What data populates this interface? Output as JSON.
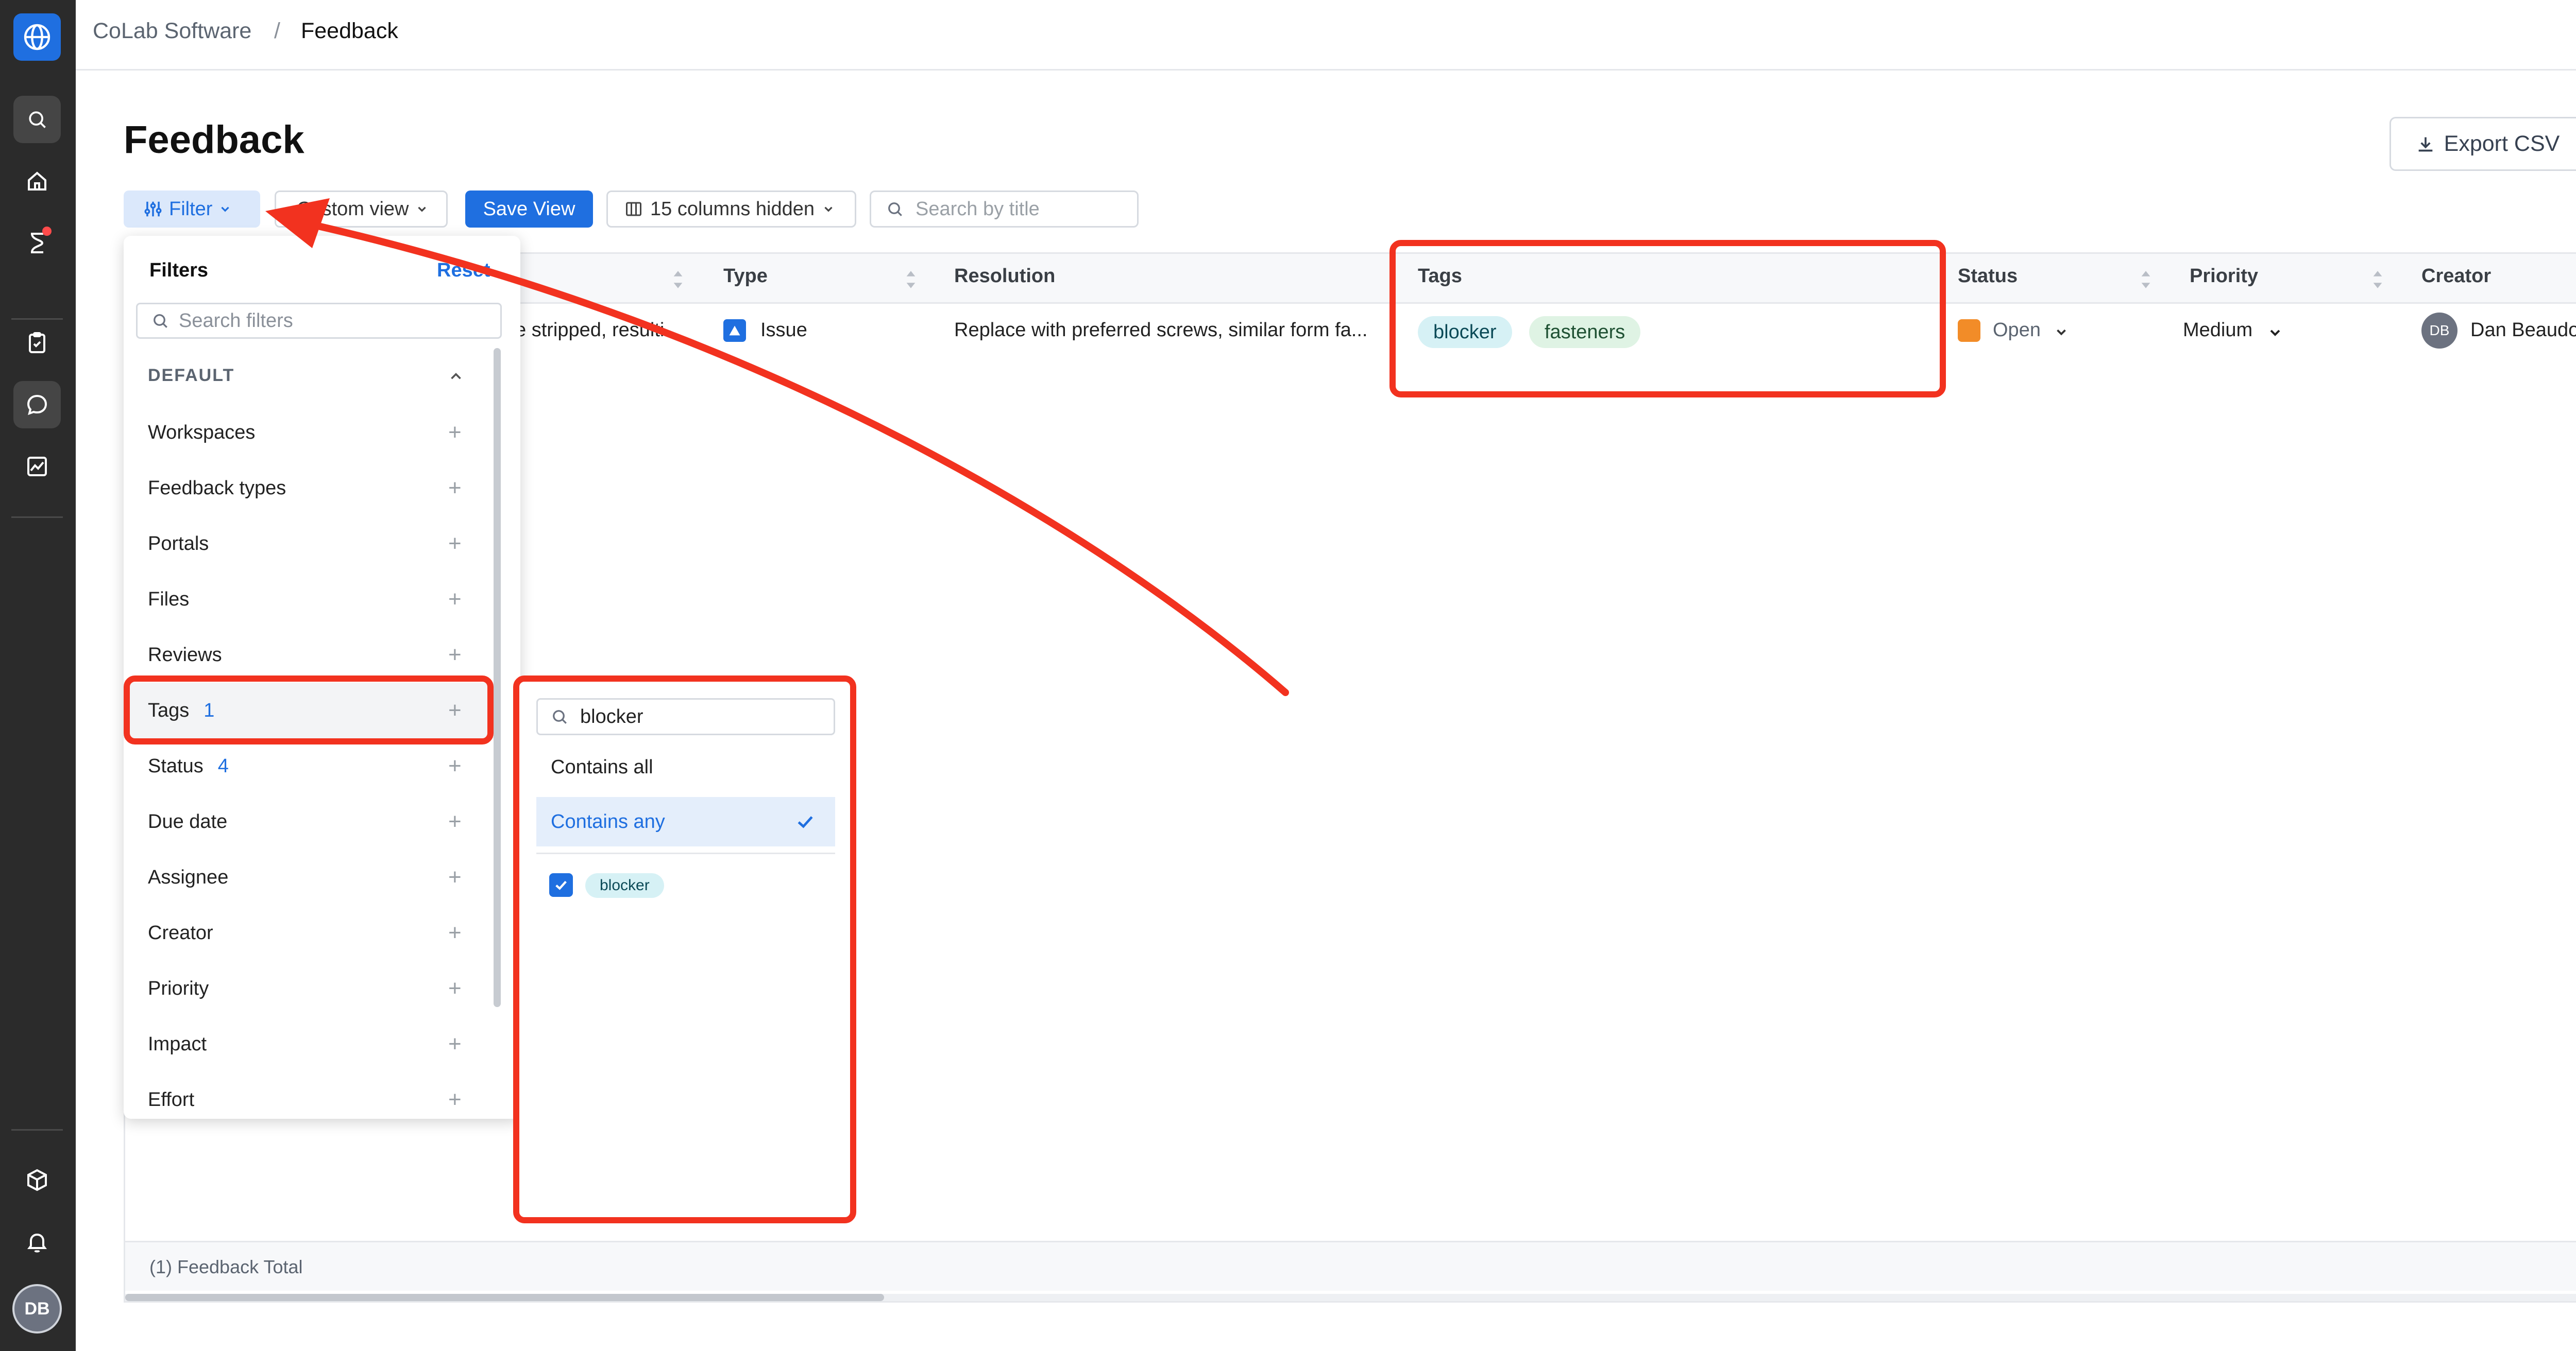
{
  "rail": {
    "items": [
      "globe-logo",
      "search",
      "home",
      "hourglass",
      "clipboard",
      "chat",
      "chart",
      "box",
      "bell"
    ],
    "avatar_initials": "DB"
  },
  "breadcrumb": {
    "workspace": "CoLab Software",
    "separator": "/",
    "current": "Feedback"
  },
  "page": {
    "title": "Feedback",
    "export_label": "Export CSV"
  },
  "toolbar": {
    "filter_label": "Filter",
    "custom_view_label": "Custom view",
    "save_view_label": "Save View",
    "columns_hidden_label": "15 columns hidden",
    "search_placeholder": "Search by title"
  },
  "table": {
    "columns": [
      "Type",
      "Resolution",
      "Tags",
      "Status",
      "Priority",
      "Creator"
    ],
    "row": {
      "description_fragment": "e stripped, resulti",
      "type": "Issue",
      "resolution": "Replace with preferred screws, similar form fa...",
      "tags": [
        "blocker",
        "fasteners"
      ],
      "status": "Open",
      "priority": "Medium",
      "creator_initials": "DB",
      "creator": "Dan Beaudoir"
    },
    "footer": "(1) Feedback Total"
  },
  "filters": {
    "title": "Filters",
    "reset_label": "Reset",
    "search_placeholder": "Search filters",
    "section": "DEFAULT",
    "items": [
      {
        "label": "Workspaces",
        "count": ""
      },
      {
        "label": "Feedback types",
        "count": ""
      },
      {
        "label": "Portals",
        "count": ""
      },
      {
        "label": "Files",
        "count": ""
      },
      {
        "label": "Reviews",
        "count": ""
      },
      {
        "label": "Tags",
        "count": "1"
      },
      {
        "label": "Status",
        "count": "4"
      },
      {
        "label": "Due date",
        "count": ""
      },
      {
        "label": "Assignee",
        "count": ""
      },
      {
        "label": "Creator",
        "count": ""
      },
      {
        "label": "Priority",
        "count": ""
      },
      {
        "label": "Impact",
        "count": ""
      },
      {
        "label": "Effort",
        "count": ""
      }
    ]
  },
  "tag_filter": {
    "search_value": "blocker",
    "options": [
      "Contains all",
      "Contains any"
    ],
    "selected_option": "Contains any",
    "checked_tag": "blocker"
  },
  "colors": {
    "accent": "#1f6fe0",
    "annotation": "#f2321f",
    "status_open": "#f28c28"
  }
}
